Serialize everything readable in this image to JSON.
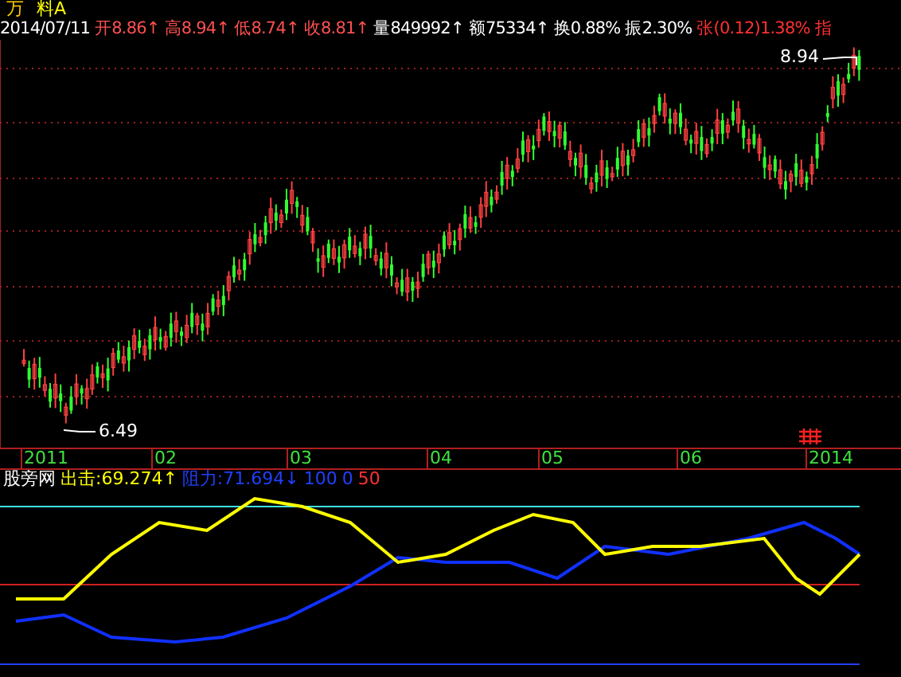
{
  "title": [
    {
      "text": "万",
      "color": "#ffcc00"
    },
    {
      "text": "料A",
      "color": "#ffff00"
    }
  ],
  "date": "2014/07/11",
  "quote": [
    {
      "text": "开8.86↑",
      "color": "#ff5050"
    },
    {
      "text": "高8.94↑",
      "color": "#ff5050"
    },
    {
      "text": "低8.74↑",
      "color": "#ff5050"
    },
    {
      "text": "收8.81↑",
      "color": "#ff5050"
    },
    {
      "text": "量849992↑",
      "color": "#ffffff"
    },
    {
      "text": "额75334↑",
      "color": "#ffffff"
    },
    {
      "text": "换0.88%",
      "color": "#ffffff"
    },
    {
      "text": "振2.30%",
      "color": "#ffffff"
    },
    {
      "text": "张(0.12)1.38%",
      "color": "#ff3030"
    },
    {
      "text": "指",
      "color": "#ff3030"
    }
  ],
  "price_chart": {
    "high_label": "8.94",
    "low_label": "6.49"
  },
  "time_axis": [
    "2011",
    "02",
    "03",
    "04",
    "05",
    "06",
    "2014"
  ],
  "indicator": {
    "name": "股旁网",
    "legend": [
      {
        "text": "出击:69.274↑",
        "color": "#ffff00"
      },
      {
        "text": "阻力:71.694↓",
        "color": "#2040ff"
      },
      {
        "text": "100",
        "color": "#2040ff"
      },
      {
        "text": "0",
        "color": "#2040ff"
      },
      {
        "text": "50",
        "color": "#ff3030"
      }
    ]
  }
}
